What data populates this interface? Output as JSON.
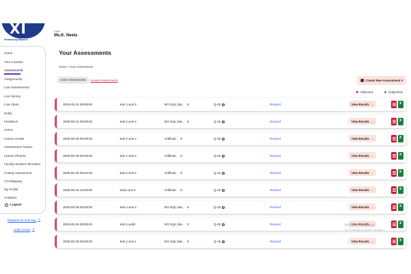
{
  "brand": {
    "logo_text": "XI",
    "powered_by": "Powered by Edusera"
  },
  "header": {
    "greeting": "Hello",
    "user_name": "Ms.K. Neela"
  },
  "sidebar": {
    "items": [
      {
        "label": "Home"
      },
      {
        "label": "Your Courses"
      },
      {
        "label": "Assessments"
      },
      {
        "label": "Assignments"
      },
      {
        "label": "Live Assessments"
      },
      {
        "label": "Live Survey"
      },
      {
        "label": "Live Class"
      },
      {
        "label": "Notify"
      },
      {
        "label": "Feedback"
      },
      {
        "label": "Arena"
      },
      {
        "label": "Lesson Hooks"
      },
      {
        "label": "Assessment Tracker"
      },
      {
        "label": "Lesson Planner"
      },
      {
        "label": "Faculty-Student Allocation"
      },
      {
        "label": "Coding Assessment"
      },
      {
        "label": "CO Mapping"
      },
      {
        "label": "My Profile"
      },
      {
        "label": "Analytics"
      }
    ],
    "logout": "Logout",
    "ios_link": "Request for iOS App",
    "help_link": "Help Center"
  },
  "main": {
    "title": "Your Assessments",
    "breadcrumb": "Home • Your Assessment",
    "tabs": {
      "active": "Active Assessments",
      "other": "Graded Assessments"
    },
    "create_button": "Create New Assessment ▾",
    "legend": {
      "objective": "Objective",
      "subjective": "Subjective",
      "objective_color": "#e11d48",
      "subjective_color": "#3b82f6"
    },
    "view_label": "View Results",
    "rows": [
      {
        "date": "2025-03-31 09:00:00",
        "name": "test 1-unit 3",
        "type": "NO SQL Dat...",
        "q": "Q-20",
        "resend": "Resend"
      },
      {
        "date": "2025-03-31 08:00:00",
        "name": "test 1-unit 4",
        "type": "NO SQL Dat...",
        "q": "Q-15",
        "resend": "Resend"
      },
      {
        "date": "2025-03-30 09:00:00",
        "name": "test 2-unit 4",
        "type": "Artificial...",
        "q": "Q-15",
        "resend": "Resend"
      },
      {
        "date": "2025-03-28 08:00:00",
        "name": "test 1-unit 4",
        "type": "Artificial...",
        "q": "Q-15",
        "resend": "Resend"
      },
      {
        "date": "2025-03-25 09:02:00",
        "name": "test 2-unit 3",
        "type": "Artificial...",
        "q": "Q-15",
        "resend": "Resend"
      },
      {
        "date": "2025-03-24 16:00:00",
        "name": "test1-unit 3",
        "type": "Artificial...",
        "q": "Q-15",
        "resend": "Resend"
      },
      {
        "date": "2025-03-28 09:00:00",
        "name": "test 2-unit 2",
        "type": "NO SQL Dat...",
        "q": "Q-15",
        "resend": "Resend"
      },
      {
        "date": "2025-03-26 08:00:00",
        "name": "test 1-unit2",
        "type": "NO SQL Dat...",
        "q": "Q-20",
        "resend": "Resend"
      },
      {
        "date": "2025-03-25 09:00:00",
        "name": "test 1-unit 1",
        "type": "NO SQL Dat...",
        "q": "Q-15",
        "resend": "Resend"
      }
    ]
  },
  "watermark": {
    "line1": "Activate Windows",
    "line2": "Go to Settings to activate Windows."
  },
  "colors": {
    "accent": "#6b2fb8",
    "row_border": "#d9475d",
    "button_bg": "#fde2dc",
    "link": "#2563eb"
  }
}
